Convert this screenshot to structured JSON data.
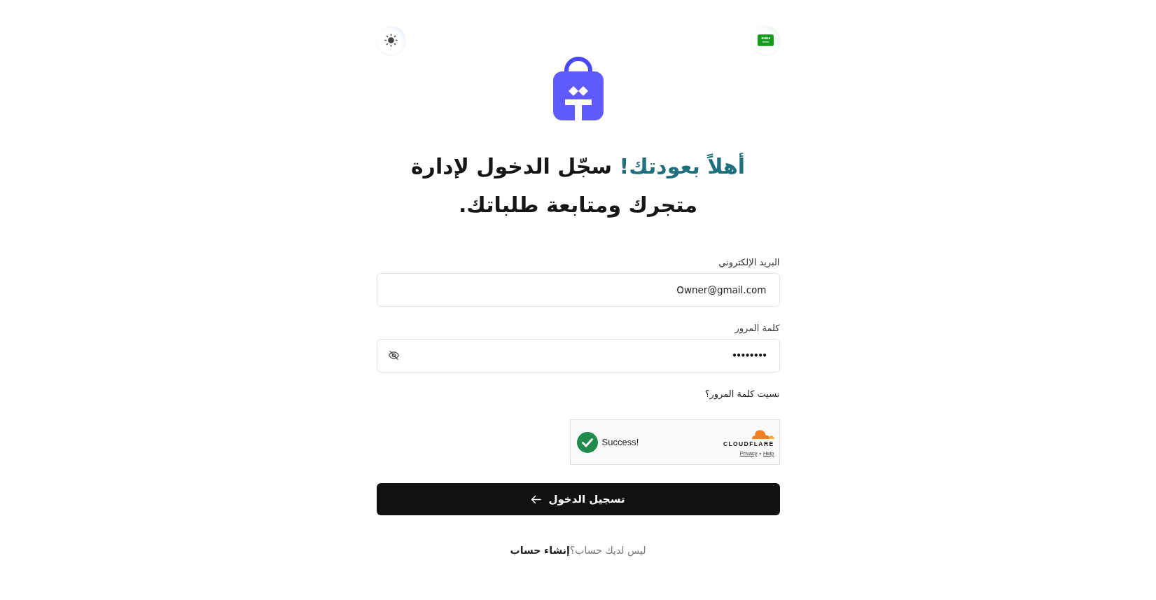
{
  "heading": [
    {
      "text": "أهلاً بعودتك!",
      "accent": true
    },
    {
      "text": "سجّل الدخول لإدارة متجرك ومتابعة طلباتك.",
      "accent": false
    }
  ],
  "form": {
    "email": {
      "label": "البريد الإلكتروني",
      "value": "Owner@gmail.com"
    },
    "password": {
      "label": "كلمة المرور",
      "value": "••••••••",
      "masked": true
    },
    "forgot_link": "نسيت كلمة المرور؟"
  },
  "captcha": {
    "verified": true,
    "status": "Success!",
    "brand": "CLOUDFLARE",
    "privacy_link": "Privacy",
    "separator": "•",
    "help_link": "Help"
  },
  "submit_button": {
    "label": "تسجيل الدخول"
  },
  "signup": {
    "prompt": "ليس لديك حساب؟",
    "link": "إنشاء حساب"
  }
}
